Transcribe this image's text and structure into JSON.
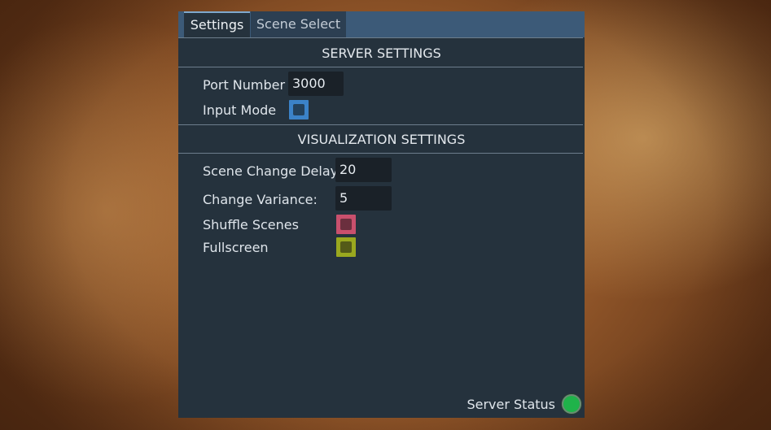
{
  "tabs": [
    {
      "label": "Settings",
      "active": true
    },
    {
      "label": "Scene Select",
      "active": false
    }
  ],
  "server_settings": {
    "title": "SERVER SETTINGS",
    "port_label": "Port Number",
    "port_value": "3000",
    "input_mode_label": "Input Mode",
    "input_mode_checked": false,
    "input_mode_color": "#3b82c8"
  },
  "visualization_settings": {
    "title": "VISUALIZATION SETTINGS",
    "scene_change_delay_label": "Scene Change Delay:",
    "scene_change_delay_value": "20",
    "change_variance_label": "Change Variance:",
    "change_variance_value": "5",
    "shuffle_scenes_label": "Shuffle Scenes",
    "shuffle_scenes_checked": false,
    "shuffle_scenes_color": "#c9506d",
    "fullscreen_label": "Fullscreen",
    "fullscreen_checked": false,
    "fullscreen_color": "#9aa81f"
  },
  "status": {
    "label": "Server Status",
    "state_color": "#1fb34a"
  }
}
